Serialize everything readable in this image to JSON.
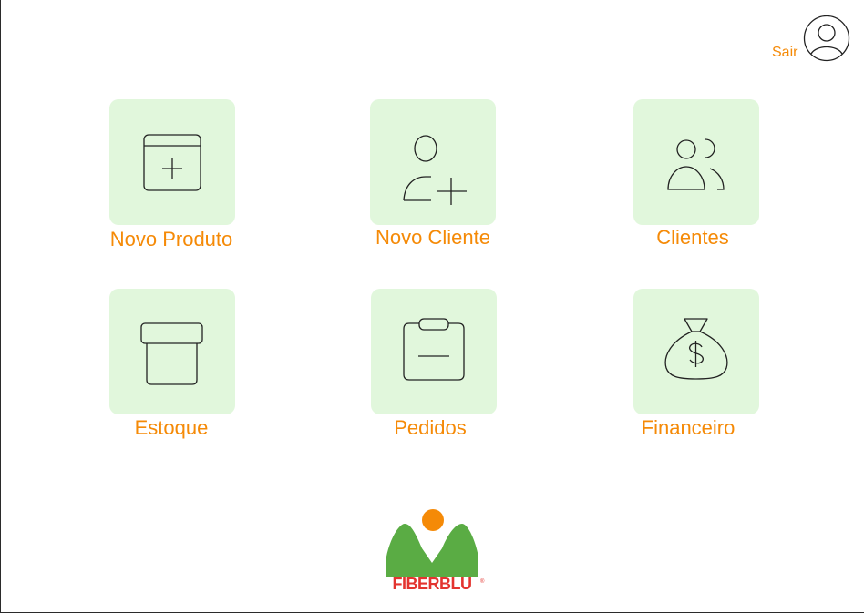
{
  "header": {
    "logout_label": "Sair",
    "avatar_icon": "user-circle-icon"
  },
  "menu": {
    "items": [
      {
        "label": "Novo Produto",
        "icon": "add-product-icon"
      },
      {
        "label": "Novo Cliente",
        "icon": "add-user-icon"
      },
      {
        "label": "Clientes",
        "icon": "users-icon"
      },
      {
        "label": "Estoque",
        "icon": "box-icon"
      },
      {
        "label": "Pedidos",
        "icon": "clipboard-icon"
      },
      {
        "label": "Financeiro",
        "icon": "money-bag-icon"
      }
    ]
  },
  "brand": {
    "logo_text": "FIBERBLU",
    "colors": {
      "accent": "#f58a07",
      "tile_bg": "#e1f7dc",
      "logo_green": "#5aac44",
      "logo_red": "#e3342f",
      "logo_sun": "#f58a07"
    }
  }
}
